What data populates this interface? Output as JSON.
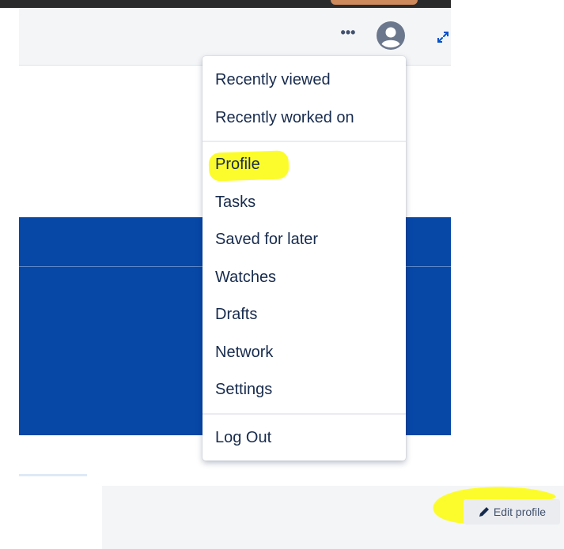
{
  "header": {
    "more_icon": "more-horizontal-icon",
    "more_glyph": "•••",
    "avatar_icon": "user-avatar-icon",
    "expand_icon": "expand-arrows-icon"
  },
  "user_menu": {
    "recent_group": [
      {
        "label": "Recently viewed"
      },
      {
        "label": "Recently worked on"
      }
    ],
    "personal_group": [
      {
        "label": "Profile",
        "highlighted": true
      },
      {
        "label": "Tasks"
      },
      {
        "label": "Saved for later"
      },
      {
        "label": "Watches"
      },
      {
        "label": "Drafts"
      },
      {
        "label": "Network"
      },
      {
        "label": "Settings"
      }
    ],
    "logout_label": "Log Out"
  },
  "profile_page": {
    "edit_profile_label": "Edit profile",
    "edit_icon": "pencil-icon"
  },
  "colors": {
    "banner": "#0747a6",
    "highlight": "#fcfc2c",
    "menu_text": "#172b4d",
    "button_bg": "#ebecf0"
  }
}
